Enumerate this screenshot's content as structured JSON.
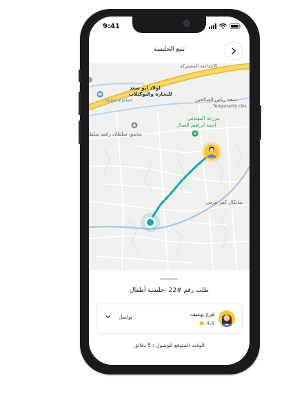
{
  "status_bar": {
    "time": "9:41"
  },
  "header": {
    "title": "تتبع الجليسة"
  },
  "map": {
    "labels": [
      "الاعدادية المشتركة",
      "اولاد ابو سعد",
      "للتجارة والتوكيلات",
      "Supermarket",
      "سجد رياض الصالحين",
      "Temporarily clos",
      "مزرعة المهندس",
      "احمد ابراهيم العمال",
      "محمود سلطان راشد سلط",
      "بنديكال كمر نبرس"
    ]
  },
  "sheet": {
    "request_title": "طلب رقم #22 -جليسة أطفال",
    "driver_name": "فرح يوسف",
    "rating": "4.6",
    "contact_label": "تواصل",
    "eta": "الوقت المتوقع للوصول : 5 دقائق"
  },
  "colors": {
    "route": "#1aa4b0",
    "highway": "#f3c842",
    "water": "#9ec2e6",
    "star": "#f2b01e",
    "avatar_bg": "#f4c431"
  }
}
